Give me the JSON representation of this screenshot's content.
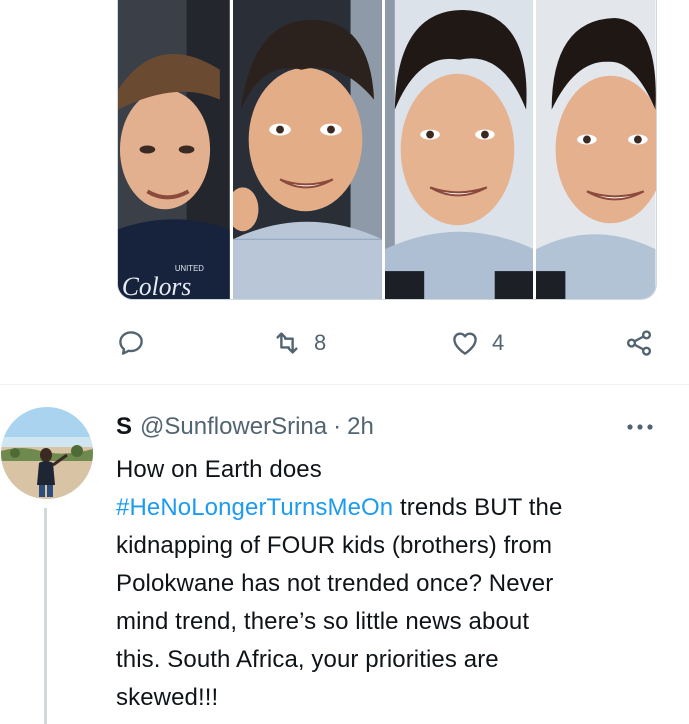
{
  "media": {
    "photos": [
      {
        "label": "boy-photo-1"
      },
      {
        "label": "boy-photo-2"
      },
      {
        "label": "boy-photo-3"
      },
      {
        "label": "boy-photo-4"
      }
    ],
    "shirt_text_top": "UNITED",
    "shirt_text_main": "Colors"
  },
  "actions": {
    "reply_icon": "reply-icon",
    "retweet_icon": "retweet-icon",
    "retweet_count": "8",
    "like_icon": "heart-icon",
    "like_count": "4",
    "share_icon": "share-icon"
  },
  "reply_tweet": {
    "display_name": "S",
    "handle": "@SunflowerSrina",
    "separator": "·",
    "time": "2h",
    "more_icon": "more-icon",
    "text_lines": {
      "line1": "How on Earth does",
      "hashtag": "#HeNoLongerTurnsMeOn",
      "line2_rest": " trends BUT the",
      "line3": "kidnapping of FOUR kids (brothers) from",
      "line4": "Polokwane has not trended once? Never",
      "line5": "mind trend, there’s so little news about",
      "line6": "this. South Africa, your priorities are",
      "line7": "skewed!!!"
    }
  },
  "colors": {
    "accent": "#1d9bf0",
    "muted": "#536471",
    "text": "#0f1419",
    "divider": "#eff3f4"
  }
}
